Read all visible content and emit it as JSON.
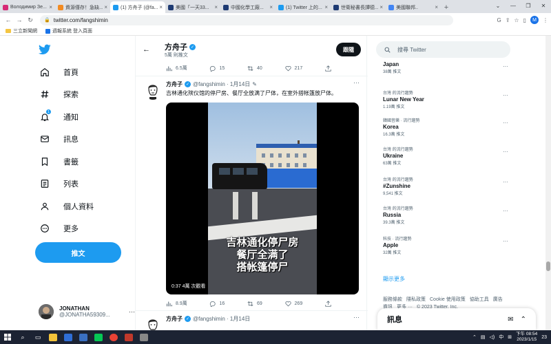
{
  "browser": {
    "tabs": [
      {
        "title": "Володимир Зе...",
        "color": "#d62976"
      },
      {
        "title": "資源僅存！急缺...",
        "color": "#f28b22"
      },
      {
        "title": "(1) 方舟子 (@fa...",
        "color": "#1d9bf0",
        "active": true
      },
      {
        "title": "美國「一天33...",
        "color": "#1f3b73"
      },
      {
        "title": "中國化學工廠...",
        "color": "#1f3b73"
      },
      {
        "title": "(1) Twitter 上的...",
        "color": "#1d9bf0"
      },
      {
        "title": "世衛秘書長譚德...",
        "color": "#1f3b73"
      },
      {
        "title": "美國聯邦..",
        "color": "#4285f4"
      }
    ],
    "new_tab": "+",
    "url": "twitter.com/fangshimin",
    "profile_initial": "M",
    "bookmarks": [
      "三立新聞網",
      "週報系統 登入頁面"
    ]
  },
  "nav": {
    "items": [
      {
        "label": "首頁",
        "icon": "home-icon"
      },
      {
        "label": "探索",
        "icon": "hashtag-icon"
      },
      {
        "label": "通知",
        "icon": "bell-icon",
        "badge": "1"
      },
      {
        "label": "訊息",
        "icon": "mail-icon"
      },
      {
        "label": "書籤",
        "icon": "bookmark-icon"
      },
      {
        "label": "列表",
        "icon": "list-icon"
      },
      {
        "label": "個人資料",
        "icon": "person-icon"
      },
      {
        "label": "更多",
        "icon": "more-circle-icon"
      }
    ],
    "tweet_button": "推文",
    "account": {
      "name": "JONATHAN",
      "handle": "@JONATHA59309..."
    }
  },
  "header": {
    "name": "方舟子",
    "subtitle": "5萬 則推文",
    "follow_label": "跟隨"
  },
  "prev_tweet_actions": {
    "views": "6.5萬",
    "replies": "15",
    "retweets": "40",
    "likes": "217"
  },
  "tweet1": {
    "name": "方舟子",
    "handle": "@fangshimin · 1月14日",
    "text": "吉林通化殡仪馆的停尸房、餐厅全放满了尸体，在室外搭帐篷放尸体。",
    "video_subtitle": [
      "吉林通化停尸房",
      "餐厅全满了",
      "搭帐篷停尸"
    ],
    "video_time": "0:37",
    "video_views": "4萬 次觀看",
    "actions": {
      "views": "8.9萬",
      "replies": "16",
      "retweets": "69",
      "likes": "269"
    }
  },
  "tweet2": {
    "name": "方舟子",
    "handle": "@fangshimin · 1月14日"
  },
  "search": {
    "placeholder": "搜尋 Twitter"
  },
  "trends": [
    {
      "context": "",
      "name": "Japan",
      "count": "38萬 推文"
    },
    {
      "context": "台灣 的流行趨勢",
      "name": "Lunar New Year",
      "count": "1.19萬 推文"
    },
    {
      "context": "韓國音樂 · 流行趨勢",
      "name": "Korea",
      "count": "16.3萬 推文"
    },
    {
      "context": "台灣 的流行趨勢",
      "name": "Ukraine",
      "count": "63萬 推文"
    },
    {
      "context": "台灣 的流行趨勢",
      "name": "#Zunshine",
      "count": "9,541 推文"
    },
    {
      "context": "台灣 的流行趨勢",
      "name": "Russia",
      "count": "39.3萬 推文"
    },
    {
      "context": "科技 · 流行趨勢",
      "name": "Apple",
      "count": "32萬 推文"
    }
  ],
  "show_more": "顯示更多",
  "footer": {
    "links": [
      "服務條款",
      "隱私政策",
      "Cookie 使用政策",
      "協助工具",
      "廣告資訊",
      "更多 ···",
      "© 2023 Twitter, Inc."
    ]
  },
  "messages": {
    "title": "訊息"
  },
  "taskbar": {
    "time": "下午 08:54",
    "date": "2023/1/15",
    "ime": "中",
    "notif": "23"
  }
}
